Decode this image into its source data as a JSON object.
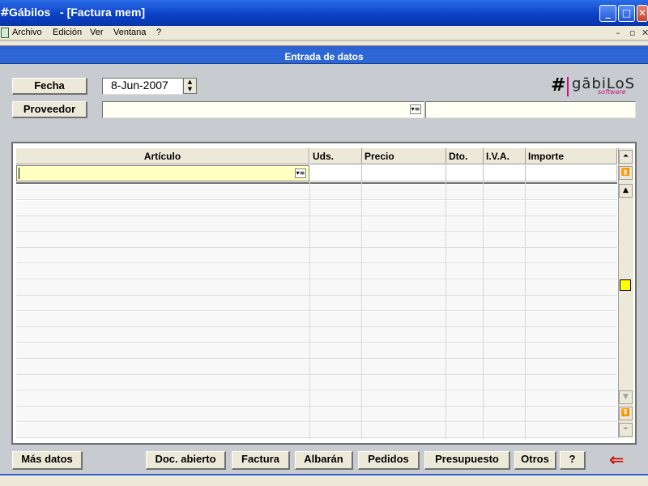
{
  "window": {
    "app_name": "Gábilos",
    "document_title": "- [Factura mem]",
    "icon": "hash-icon",
    "controls": [
      "minimize",
      "maximize",
      "close"
    ]
  },
  "menu": {
    "items": [
      "Archivo",
      "Edición",
      "Ver",
      "Ventana",
      "?"
    ],
    "mdi_controls": [
      "–",
      "▫",
      "✕"
    ]
  },
  "section_title": "Entrada de datos",
  "header_form": {
    "fecha_label": "Fecha",
    "fecha_value": "8-Jun-2007",
    "proveedor_label": "Proveedor",
    "proveedor_value": ""
  },
  "logo": {
    "name": "gābiLoS",
    "sub": "software"
  },
  "grid": {
    "columns": [
      "Artículo",
      "Uds.",
      "Precio",
      "Dto.",
      "I.V.A.",
      "Importe"
    ],
    "empty_rows": 16
  },
  "buttons": {
    "mas_datos": "Más datos",
    "doc_abierto": "Doc. abierto",
    "factura": "Factura",
    "albaran": "Albarán",
    "pedidos": "Pedidos",
    "presupuesto": "Presupuesto",
    "otros": "Otros",
    "help": "?"
  },
  "colors": {
    "titlebar": "#0a3fc4",
    "section_header": "#2d67d6",
    "entry_highlight": "#ffffc0",
    "exit_arrow": "#d01010",
    "logo_accent": "#c0187a"
  }
}
